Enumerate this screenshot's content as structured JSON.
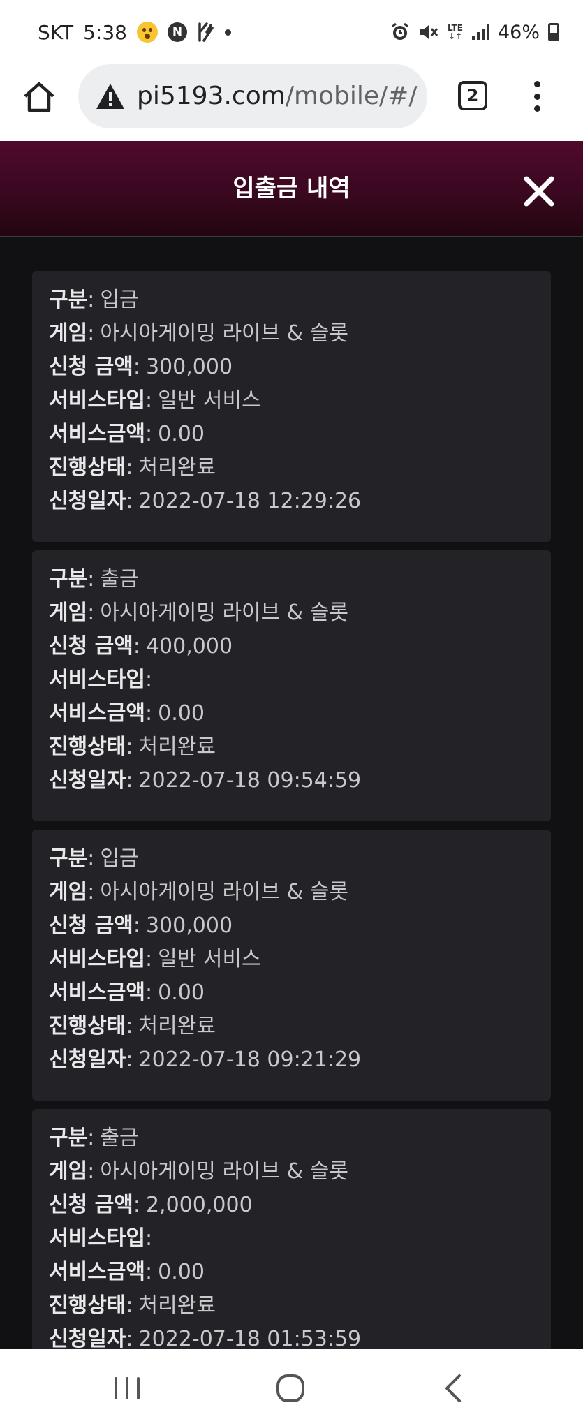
{
  "status_bar": {
    "carrier": "SKT",
    "time": "5:38",
    "network": "LTE",
    "battery": "46%",
    "icons": [
      "emoji-face-icon",
      "n-notification-icon",
      "flash-notification-icon",
      "dot-icon",
      "alarm-icon",
      "mute-icon",
      "lte-icon",
      "signal-icon",
      "battery-icon"
    ]
  },
  "browser": {
    "url_host": "pi5193.com",
    "url_path": "/mobile/#/",
    "tab_count": "2",
    "icons": [
      "home-icon",
      "warning-icon",
      "tabs-icon",
      "more-vert-icon"
    ]
  },
  "header": {
    "title": "입출금 내역",
    "gradient_colors": [
      "#4f0a2b",
      "#22060f"
    ],
    "icons": [
      "close-icon"
    ]
  },
  "labels": {
    "type": "구분",
    "game": "게임",
    "amount": "신청 금액",
    "service_type": "서비스타입",
    "service_amount": "서비스금액",
    "status": "진행상태",
    "date": "신청일자",
    "separator": ":"
  },
  "transactions": [
    {
      "type": "입금",
      "game": "아시아게이밍 라이브 & 슬롯",
      "amount": "300,000",
      "service_type": "일반 서비스",
      "service_amount": "0.00",
      "status": "처리완료",
      "date": "2022-07-18 12:29:26"
    },
    {
      "type": "출금",
      "game": "아시아게이밍 라이브 & 슬롯",
      "amount": "400,000",
      "service_type": "",
      "service_amount": "0.00",
      "status": "처리완료",
      "date": "2022-07-18 09:54:59"
    },
    {
      "type": "입금",
      "game": "아시아게이밍 라이브 & 슬롯",
      "amount": "300,000",
      "service_type": "일반 서비스",
      "service_amount": "0.00",
      "status": "처리완료",
      "date": "2022-07-18 09:21:29"
    },
    {
      "type": "출금",
      "game": "아시아게이밍 라이브 & 슬롯",
      "amount": "2,000,000",
      "service_type": "",
      "service_amount": "0.00",
      "status": "처리완료",
      "date": "2022-07-18 01:53:59"
    }
  ],
  "nav_bar": {
    "icons": [
      "recent-apps-icon",
      "home-nav-icon",
      "back-icon"
    ]
  }
}
